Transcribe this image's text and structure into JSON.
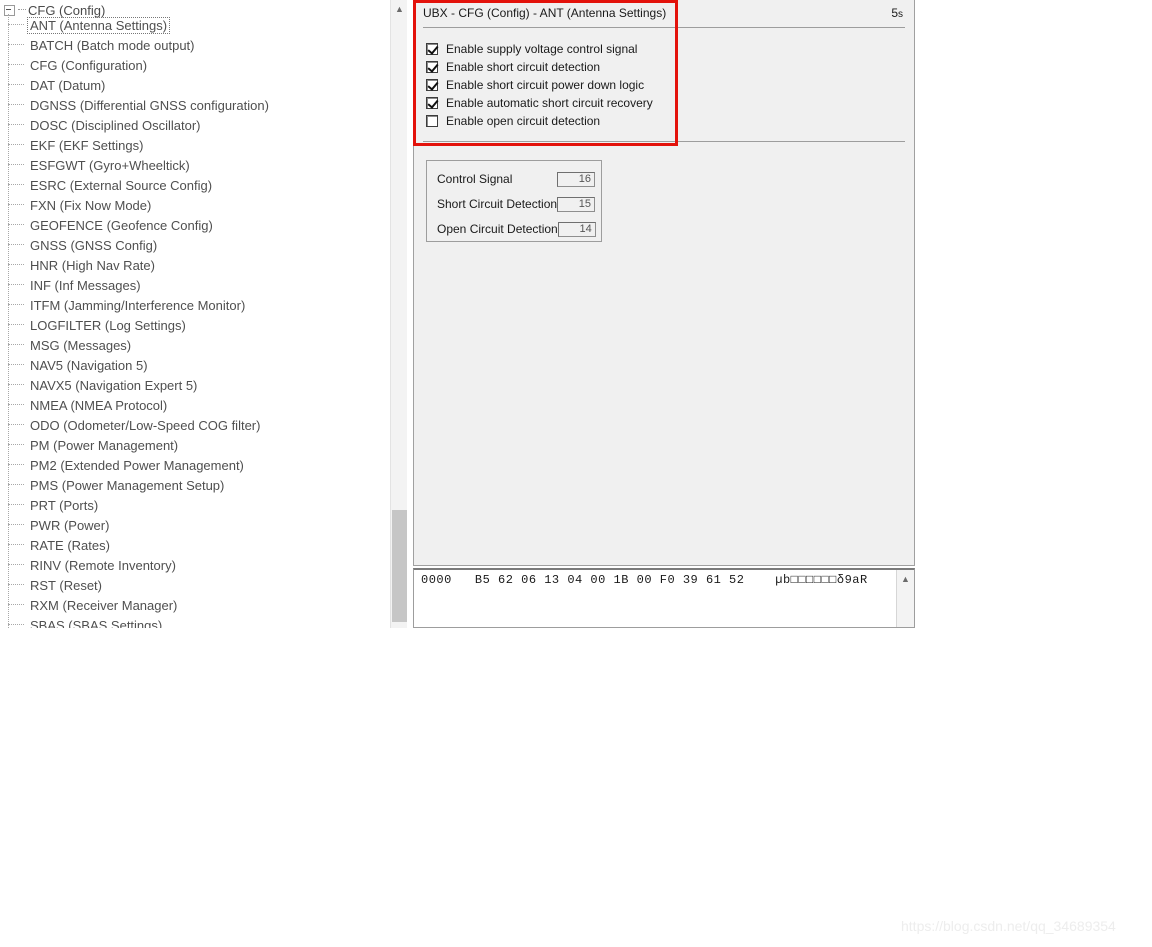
{
  "tree": {
    "root": {
      "label": "CFG (Config)",
      "expander": "minus-box",
      "expanded": true
    },
    "selected_item": "ANT (Antenna Settings)",
    "items": [
      {
        "label": "ANT (Antenna Settings)",
        "selected": true
      },
      {
        "label": "BATCH (Batch mode output)",
        "selected": false
      },
      {
        "label": "CFG (Configuration)",
        "selected": false
      },
      {
        "label": "DAT (Datum)",
        "selected": false
      },
      {
        "label": "DGNSS (Differential GNSS configuration)",
        "selected": false
      },
      {
        "label": "DOSC (Disciplined Oscillator)",
        "selected": false
      },
      {
        "label": "EKF (EKF Settings)",
        "selected": false
      },
      {
        "label": "ESFGWT (Gyro+Wheeltick)",
        "selected": false
      },
      {
        "label": "ESRC (External Source Config)",
        "selected": false
      },
      {
        "label": "FXN (Fix Now Mode)",
        "selected": false
      },
      {
        "label": "GEOFENCE (Geofence Config)",
        "selected": false
      },
      {
        "label": "GNSS (GNSS Config)",
        "selected": false
      },
      {
        "label": "HNR (High Nav Rate)",
        "selected": false
      },
      {
        "label": "INF (Inf Messages)",
        "selected": false
      },
      {
        "label": "ITFM (Jamming/Interference Monitor)",
        "selected": false
      },
      {
        "label": "LOGFILTER (Log Settings)",
        "selected": false
      },
      {
        "label": "MSG (Messages)",
        "selected": false
      },
      {
        "label": "NAV5 (Navigation 5)",
        "selected": false
      },
      {
        "label": "NAVX5 (Navigation Expert 5)",
        "selected": false
      },
      {
        "label": "NMEA (NMEA Protocol)",
        "selected": false
      },
      {
        "label": "ODO (Odometer/Low-Speed COG filter)",
        "selected": false
      },
      {
        "label": "PM (Power Management)",
        "selected": false
      },
      {
        "label": "PM2 (Extended Power Management)",
        "selected": false
      },
      {
        "label": "PMS (Power Management Setup)",
        "selected": false
      },
      {
        "label": "PRT (Ports)",
        "selected": false
      },
      {
        "label": "PWR (Power)",
        "selected": false
      },
      {
        "label": "RATE (Rates)",
        "selected": false
      },
      {
        "label": "RINV (Remote Inventory)",
        "selected": false
      },
      {
        "label": "RST (Reset)",
        "selected": false
      },
      {
        "label": "RXM (Receiver Manager)",
        "selected": false
      },
      {
        "label": "SBAS (SBAS Settings)",
        "selected": false
      }
    ],
    "scrollbar": {
      "up_arrow": "chevron-up-icon"
    }
  },
  "config": {
    "title": "UBX - CFG (Config) - ANT (Antenna Settings)",
    "poll_rate": "5",
    "poll_rate_unit": "s",
    "checkboxes": [
      {
        "label": "Enable supply voltage control signal",
        "checked": true
      },
      {
        "label": "Enable short circuit detection",
        "checked": true
      },
      {
        "label": "Enable short circuit power down logic",
        "checked": true
      },
      {
        "label": "Enable automatic short circuit recovery",
        "checked": true
      },
      {
        "label": "Enable open circuit detection",
        "checked": false
      }
    ],
    "pin_group": {
      "rows": [
        {
          "label": "Control Signal",
          "value": "16"
        },
        {
          "label": "Short Circuit Detection",
          "value": "15"
        },
        {
          "label": "Open Circuit Detection",
          "value": "14"
        }
      ]
    },
    "highlight_color": "#e3120b"
  },
  "hex_dump": {
    "line": "0000   B5 62 06 13 04 00 1B 00 F0 39 61 52    µb□□□□□□δ9aR",
    "scrollbar": {
      "up_arrow": "chevron-up-icon"
    }
  },
  "watermark": {
    "text": "https://blog.csdn.net/qq_34689354"
  }
}
